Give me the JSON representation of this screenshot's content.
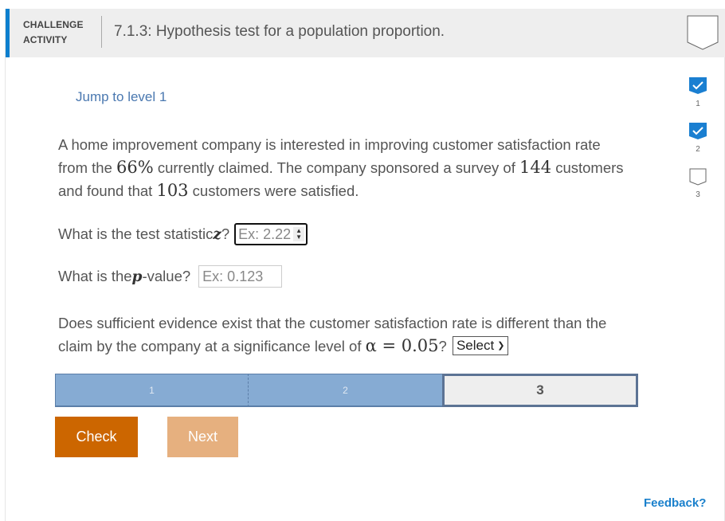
{
  "header": {
    "category_line1": "CHALLENGE",
    "category_line2": "ACTIVITY",
    "title": "7.1.3: Hypothesis test for a population proportion.",
    "accent_color": "#0d7fce",
    "completion_icon": "empty-badge-icon"
  },
  "jump_link": "Jump to level 1",
  "problem": {
    "part1": "A home improvement company is interested in improving customer satisfaction rate from the ",
    "rate": "66%",
    "part2": " currently claimed. The company sponsored a survey of ",
    "sample_size": "144",
    "part3": " customers and found that ",
    "satisfied": "103",
    "part4": " customers were satisfied."
  },
  "questions": {
    "z": {
      "label": "What is the test statistic ",
      "var": "z",
      "suffix": "?",
      "placeholder": "Ex: 2.22"
    },
    "p": {
      "label_pre": "What is the ",
      "var": "p",
      "label_post": "-value?",
      "placeholder": "Ex: 0.123"
    },
    "evidence": {
      "text": "Does sufficient evidence exist that the customer satisfaction rate is different than the claim by the company at a significance level of ",
      "alpha": "α = 0.05",
      "suffix": "?",
      "select_value": "Select"
    }
  },
  "levels": {
    "items": [
      {
        "label": "1",
        "status": "completed"
      },
      {
        "label": "2",
        "status": "completed"
      },
      {
        "label": "3",
        "status": "current"
      }
    ]
  },
  "buttons": {
    "check": "Check",
    "next": "Next"
  },
  "feedback": "Feedback?",
  "side_levels": [
    {
      "label": "1",
      "status": "completed",
      "icon": "checkmark-icon"
    },
    {
      "label": "2",
      "status": "completed",
      "icon": "checkmark-icon"
    },
    {
      "label": "3",
      "status": "incomplete",
      "icon": "empty-badge-icon"
    }
  ],
  "colors": {
    "check_button": "#cc6600",
    "next_button": "#e6b07f",
    "completed_level": "#86abd3",
    "link": "#1a80cc"
  }
}
